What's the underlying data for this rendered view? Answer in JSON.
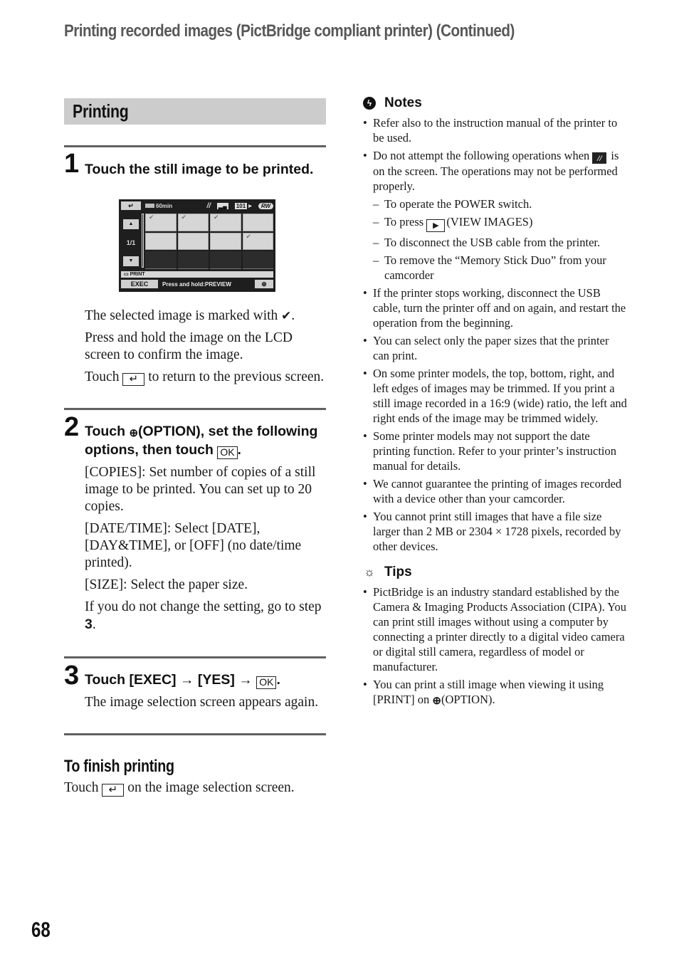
{
  "header": {
    "title": "Printing recorded images (PictBridge compliant printer) (Continued)"
  },
  "section": {
    "title": "Printing"
  },
  "steps": [
    {
      "number": "1",
      "title": "Touch the still image to be printed.",
      "lcd": {
        "back_label": "↵",
        "battery": "60min",
        "icons": [
          "pictbridge-icon",
          "folder-icon",
          "101",
          "rw-disc-icon"
        ],
        "folder_label": "▂▄",
        "folder_num": "101",
        "disc_label": "RW",
        "up_label": "▲",
        "down_label": "▼",
        "page": "1/1",
        "cells": [
          true,
          true,
          true,
          false,
          false,
          false,
          false,
          true
        ],
        "print_label": "PRINT",
        "exec_label": "EXEC",
        "hint": "Press and hold:PREVIEW",
        "option_label": "⊕"
      },
      "paras": {
        "selected": "The selected image is marked with",
        "check": "✔",
        "press": "Press and hold the image on the LCD screen to confirm the image.",
        "touch": "Touch",
        "back_icon": "↵",
        "touch_rest": "to return to the previous screen."
      }
    },
    {
      "number": "2",
      "title_a": "Touch",
      "option_icon": "⊕",
      "title_b": "(OPTION), set the following options, then touch",
      "ok": "OK",
      "paras": [
        "[COPIES]: Set number of copies of a still image to be printed. You can set up to 20 copies.",
        "[DATE/TIME]: Select [DATE], [DAY&TIME], or [OFF] (no date/time printed).",
        "[SIZE]: Select the paper size."
      ],
      "goto_a": "If you do not change the setting, go to step",
      "goto_step": "3"
    },
    {
      "number": "3",
      "title": "Touch [EXEC] → [YES] →",
      "ok": "OK",
      "para": "The image selection screen appears again."
    }
  ],
  "finish": {
    "title": "To finish printing",
    "touch": "Touch",
    "back_icon": "↵",
    "rest": "on the image selection screen."
  },
  "notes": {
    "title": "Notes",
    "item1": "Refer also to the instruction manual of the printer to be used.",
    "item2_a": "Do not attempt the following operations when",
    "item2_icon": "//",
    "item2_b": "is on the screen. The operations may not be performed properly.",
    "sub": {
      "s1": "To operate the POWER switch.",
      "s2_a": "To press",
      "s2_icon": "▶",
      "s2_b": "(VIEW IMAGES)",
      "s3": "To disconnect the USB cable from the printer.",
      "s4": "To remove the “Memory Stick Duo” from your camcorder"
    },
    "items": [
      "If the printer stops working, disconnect the USB cable, turn the printer off and on again, and restart the operation from the beginning.",
      "You can select only the paper sizes that the printer can print.",
      "On some printer models, the top, bottom, right, and left edges of images may be trimmed. If you print a still image recorded in a 16:9 (wide) ratio, the left and right ends of the image may be trimmed widely.",
      "Some printer models may not support the date printing function. Refer to your printer’s instruction manual for details.",
      "We cannot guarantee the printing of images recorded with a device other than your camcorder.",
      "You cannot print still images that have a file size larger than 2 MB or 2304 × 1728 pixels, recorded by other devices."
    ]
  },
  "tips": {
    "title": "Tips",
    "item1": "PictBridge is an industry standard established by the Camera & Imaging Products Association (CIPA). You can print still images without using a computer by connecting a printer directly to a digital video camera or digital still camera, regardless of model or manufacturer.",
    "item2_a": "You can print a still image when viewing it using [PRINT] on",
    "item2_icon": "⊕",
    "item2_b": "(OPTION)."
  },
  "page_number": "68"
}
